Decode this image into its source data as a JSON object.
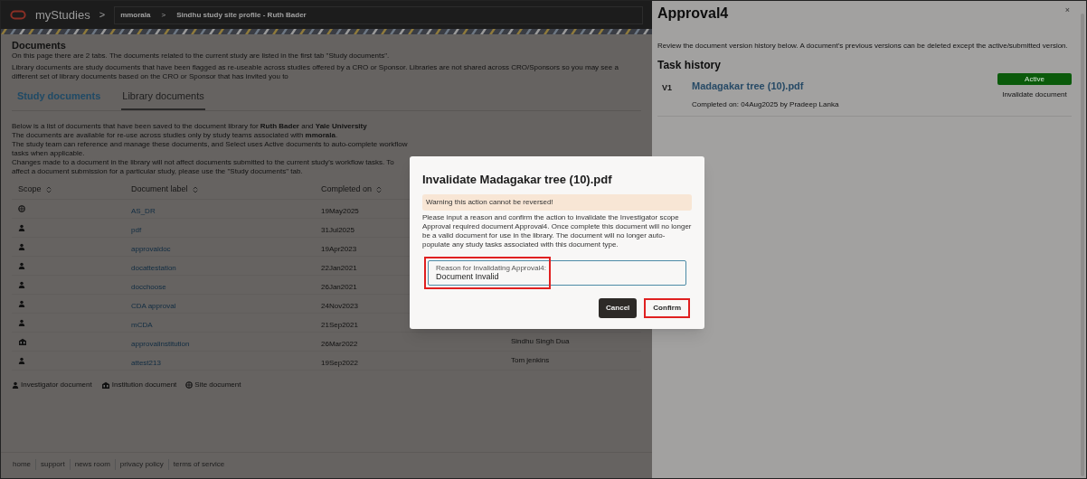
{
  "header": {
    "app_name": "myStudies",
    "separator_1": ">",
    "breadcrumb_1": "mmorala",
    "separator_2": ">",
    "breadcrumb_2": "Sindhu study site profile - Ruth Bader"
  },
  "page": {
    "title": "Documents",
    "intro": "On this page there are 2 tabs. The documents related to the current study are listed in the first tab \"Study documents\".",
    "library_note": "Library documents are study documents that have been flagged as re-useable across studies offered by a CRO or Sponsor. Libraries are not shared across CRO/Sponsors so you may see a different set of library documents based on the CRO or Sponsor that has invited you to"
  },
  "tabs": [
    {
      "label": "Study documents",
      "selected": false
    },
    {
      "label": "Library documents",
      "selected": true
    }
  ],
  "library_info": [
    "Below is a list of documents that have been saved to the document library for **Ruth Bader** and **Yale University**",
    "The documents are available for re-use across studies only by study teams associated with **mmorala**.",
    "The study team can reference and manage these documents, and Select uses Active documents to auto-complete workflow tasks when applicable.",
    "Changes made to a document in the library will not affect documents submitted to the current study's workflow tasks. To affect a document submission for a particular study, please use the \"Study documents\" tab."
  ],
  "table": {
    "columns": [
      "Scope",
      "Document label",
      "Completed on"
    ],
    "rows": [
      {
        "kind": "site",
        "label": "AS_DR",
        "completed": "19May2025"
      },
      {
        "kind": "investigator",
        "label": "pdf",
        "completed": "31Jul2025"
      },
      {
        "kind": "investigator",
        "label": "approvaldoc",
        "completed": "19Apr2023"
      },
      {
        "kind": "investigator",
        "label": "docattestation",
        "completed": "22Jan2021"
      },
      {
        "kind": "investigator",
        "label": "docchoose",
        "completed": "26Jan2021"
      },
      {
        "kind": "investigator",
        "label": "CDA approval",
        "completed": "24Nov2023"
      },
      {
        "kind": "investigator",
        "label": "mCDA",
        "completed": "21Sep2021"
      },
      {
        "kind": "institution",
        "label": "approvalinstitution",
        "completed": "26Mar2022",
        "column_4": "Sindhu Singh Dua"
      },
      {
        "kind": "investigator",
        "label": "attest213",
        "completed": "19Sep2022",
        "column_4": "Tom jenkins"
      }
    ]
  },
  "legend": [
    {
      "kind": "investigator",
      "label": "Investigator document"
    },
    {
      "kind": "institution",
      "label": "Institution document"
    },
    {
      "kind": "site",
      "label": "Site document"
    }
  ],
  "footer": [
    "home",
    "support",
    "news room",
    "privacy policy",
    "terms of service"
  ],
  "side_panel": {
    "title": "Approval4",
    "close": "×",
    "description": "Review the document version history below. A document's previous versions can be deleted except the active/submitted version.",
    "section_title": "Task history",
    "versions": [
      {
        "version": "V1",
        "file": "Madagakar tree (10).pdf",
        "status": "Active",
        "action": "Invalidate document",
        "completed": "Completed on: 04Aug2025 by Pradeep Lanka"
      }
    ]
  },
  "dialog": {
    "title": "Invalidate Madagakar tree (10).pdf",
    "warning": "Warning this action cannot be reversed!",
    "message": "Please input a reason and confirm the action to invalidate the Investigator scope Approval required document Approval4. Once complete this document will no longer be a valid document for use in the library. The document will no longer auto-populate any study tasks associated with this document type.",
    "field_label": "Reason for Invalidating Approval4:",
    "field_value": "Document Invalid",
    "buttons": [
      "Cancel",
      "Confirm"
    ]
  }
}
